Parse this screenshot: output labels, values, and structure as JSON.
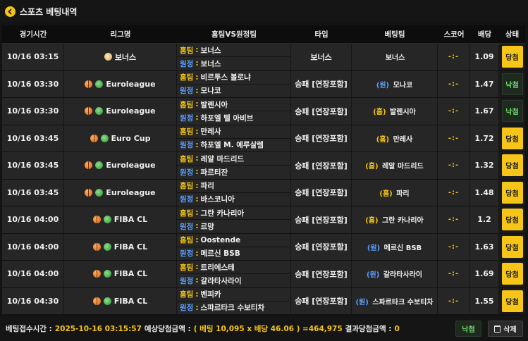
{
  "header": {
    "title": "스포츠 베팅내역"
  },
  "columns": {
    "time": "경기시간",
    "league": "리그명",
    "teams": "홈팀VS원정팀",
    "type": "타입",
    "pick": "베팅팀",
    "score": "스코어",
    "odds": "배당",
    "status": "상태"
  },
  "labels": {
    "home": "홈팀",
    "away": "원정"
  },
  "rows": [
    {
      "time": "10/16 03:15",
      "league": "보너스",
      "league_icon": "coin-icon",
      "home": "보너스",
      "away": "보너스",
      "type": "보너스",
      "pick_tag": "",
      "pick_side": "",
      "pick": "보너스",
      "score": "-:-",
      "odds": "1.09",
      "status": "당첨"
    },
    {
      "time": "10/16 03:30",
      "league": "Euroleague",
      "league_icon": "basketball-icon",
      "home": "비르투스 볼로냐",
      "away": "모나코",
      "type": "승패 [연장포함]",
      "pick_tag": "(원)",
      "pick_side": "away",
      "pick": "모나코",
      "score": "-:-",
      "odds": "1.47",
      "status": "낙첨"
    },
    {
      "time": "10/16 03:30",
      "league": "Euroleague",
      "league_icon": "basketball-icon",
      "home": "발렌시아",
      "away": "하포엘 텔 아비브",
      "type": "승패 [연장포함]",
      "pick_tag": "(홈)",
      "pick_side": "home",
      "pick": "발렌시아",
      "score": "-:-",
      "odds": "1.67",
      "status": "낙첨"
    },
    {
      "time": "10/16 03:45",
      "league": "Euro Cup",
      "league_icon": "basketball-icon",
      "home": "만레사",
      "away": "하포엘 M. 예루살렘",
      "type": "승패 [연장포함]",
      "pick_tag": "(홈)",
      "pick_side": "home",
      "pick": "만레사",
      "score": "-:-",
      "odds": "1.72",
      "status": "당첨"
    },
    {
      "time": "10/16 03:45",
      "league": "Euroleague",
      "league_icon": "basketball-icon",
      "home": "레알 마드리드",
      "away": "파르티잔",
      "type": "승패 [연장포함]",
      "pick_tag": "(홈)",
      "pick_side": "home",
      "pick": "레알 마드리드",
      "score": "-:-",
      "odds": "1.32",
      "status": "당첨"
    },
    {
      "time": "10/16 03:45",
      "league": "Euroleague",
      "league_icon": "basketball-icon",
      "home": "파리",
      "away": "바스코니아",
      "type": "승패 [연장포함]",
      "pick_tag": "(홈)",
      "pick_side": "home",
      "pick": "파리",
      "score": "-:-",
      "odds": "1.48",
      "status": "당첨"
    },
    {
      "time": "10/16 04:00",
      "league": "FIBA CL",
      "league_icon": "basketball-icon",
      "home": "그란 카나리아",
      "away": "르망",
      "type": "승패 [연장포함]",
      "pick_tag": "(홈)",
      "pick_side": "home",
      "pick": "그란 카나리아",
      "score": "-:-",
      "odds": "1.2",
      "status": "당첨"
    },
    {
      "time": "10/16 04:00",
      "league": "FIBA CL",
      "league_icon": "basketball-icon",
      "home": "Oostende",
      "away": "메르신 BSB",
      "type": "승패 [연장포함]",
      "pick_tag": "(원)",
      "pick_side": "away",
      "pick": "메르신 BSB",
      "score": "-:-",
      "odds": "1.63",
      "status": "당첨"
    },
    {
      "time": "10/16 04:00",
      "league": "FIBA CL",
      "league_icon": "basketball-icon",
      "home": "트리에스테",
      "away": "갈라타사라이",
      "type": "승패 [연장포함]",
      "pick_tag": "(원)",
      "pick_side": "away",
      "pick": "갈라타사라이",
      "score": "-:-",
      "odds": "1.69",
      "status": "당첨"
    },
    {
      "time": "10/16 04:30",
      "league": "FIBA CL",
      "league_icon": "basketball-icon",
      "home": "벤피카",
      "away": "스파르타크 수보티차",
      "type": "승패 [연장포함]",
      "pick_tag": "(원)",
      "pick_side": "away",
      "pick": "스파르타크 수보티차",
      "score": "-:-",
      "odds": "1.55",
      "status": "당첨"
    }
  ],
  "footer": {
    "bet_time_label": "베팅접수시간 :",
    "bet_time": "2025-10-16 03:15:57",
    "expected_label": "예상당첨금액 :",
    "expected": "( 베팅 10,095 x 배당 46.06 ) =464,975",
    "result_label": "결과당첨금액 :",
    "result": "0",
    "status_button": "낙첨",
    "delete_button": "삭제"
  },
  "colors": {
    "accent": "#f5c518",
    "away": "#5aa0ff",
    "lose": "#6fd86f"
  }
}
